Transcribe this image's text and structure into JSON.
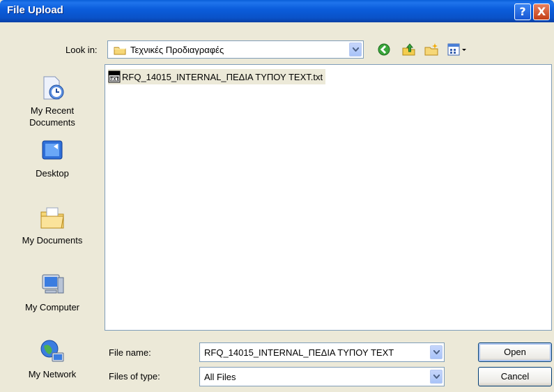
{
  "window": {
    "title": "File Upload",
    "help_label": "?",
    "close_label": "X"
  },
  "look_in": {
    "label": "Look in:",
    "value": "Τεχνικές Προδιαγραφές"
  },
  "places": [
    {
      "label_line1": "My Recent",
      "label_line2": "Documents",
      "icon": "recent-documents-icon"
    },
    {
      "label_line1": "Desktop",
      "label_line2": "",
      "icon": "desktop-icon"
    },
    {
      "label_line1": "My Documents",
      "label_line2": "",
      "icon": "my-documents-icon"
    },
    {
      "label_line1": "My Computer",
      "label_line2": "",
      "icon": "my-computer-icon"
    },
    {
      "label_line1": "My Network",
      "label_line2": "",
      "icon": "my-network-icon"
    }
  ],
  "files": [
    {
      "name": "RFQ_14015_INTERNAL_ΠΕΔΙΑ ΤΥΠΟΥ TEXT.txt",
      "icon": "txt-file-icon"
    }
  ],
  "file_name": {
    "label": "File name:",
    "value": "RFQ_14015_INTERNAL_ΠΕΔΙΑ ΤΥΠΟΥ TEXT"
  },
  "file_type": {
    "label": "Files of type:",
    "value": "All Files"
  },
  "buttons": {
    "open": "Open",
    "cancel": "Cancel"
  }
}
